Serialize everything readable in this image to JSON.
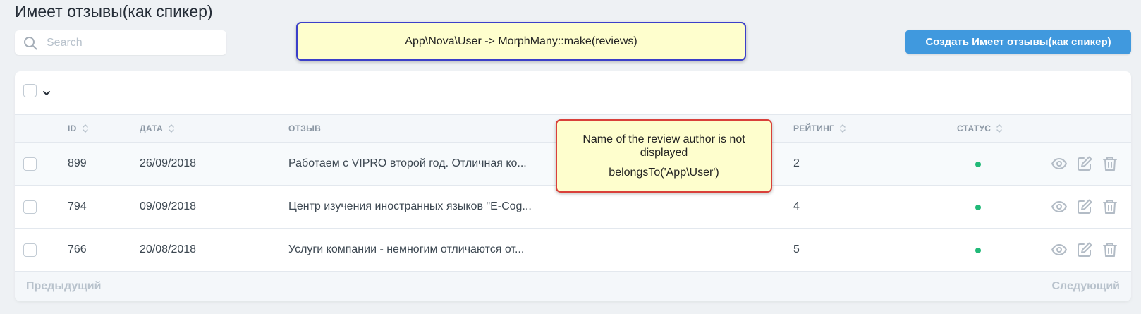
{
  "page": {
    "title": "Имеет отзывы(как спикер)"
  },
  "search": {
    "placeholder": "Search",
    "value": ""
  },
  "create_button": {
    "label": "Создать Имеет отзывы(как спикер)"
  },
  "table": {
    "columns": {
      "id": "ID",
      "date": "ДАТА",
      "review": "ОТЗЫВ",
      "rating": "РЕЙТИНГ",
      "status": "СТАТУС"
    },
    "rows": [
      {
        "id": "899",
        "date": "26/09/2018",
        "review": "Работаем с VIPRO второй год. Отличная ко...",
        "rating": "2",
        "status": "active"
      },
      {
        "id": "794",
        "date": "09/09/2018",
        "review": "Центр изучения иностранных языков \"E-Cog...",
        "rating": "4",
        "status": "active"
      },
      {
        "id": "766",
        "date": "20/08/2018",
        "review": "Услуги компании - немногим отличаются от...",
        "rating": "5",
        "status": "active"
      }
    ]
  },
  "pagination": {
    "previous": "Предыдущий",
    "next": "Следующий"
  },
  "annotations": {
    "relation_note": "App\\Nova\\User -> MorphMany::make(reviews)",
    "author_note_line1": "Name of the review author is not displayed",
    "author_note_line2": "belongsTo('App\\User')"
  },
  "colors": {
    "primary": "#4099de",
    "status_active": "#21b978",
    "note_blue_border": "#3b3fc9",
    "note_red_border": "#d9403a",
    "note_background": "#fefecd"
  },
  "icons": {
    "search": "search-icon",
    "select_dropdown": "chevron-down-icon",
    "sort": "sort-icon",
    "view": "eye-icon",
    "edit": "edit-icon",
    "delete": "trash-icon"
  }
}
